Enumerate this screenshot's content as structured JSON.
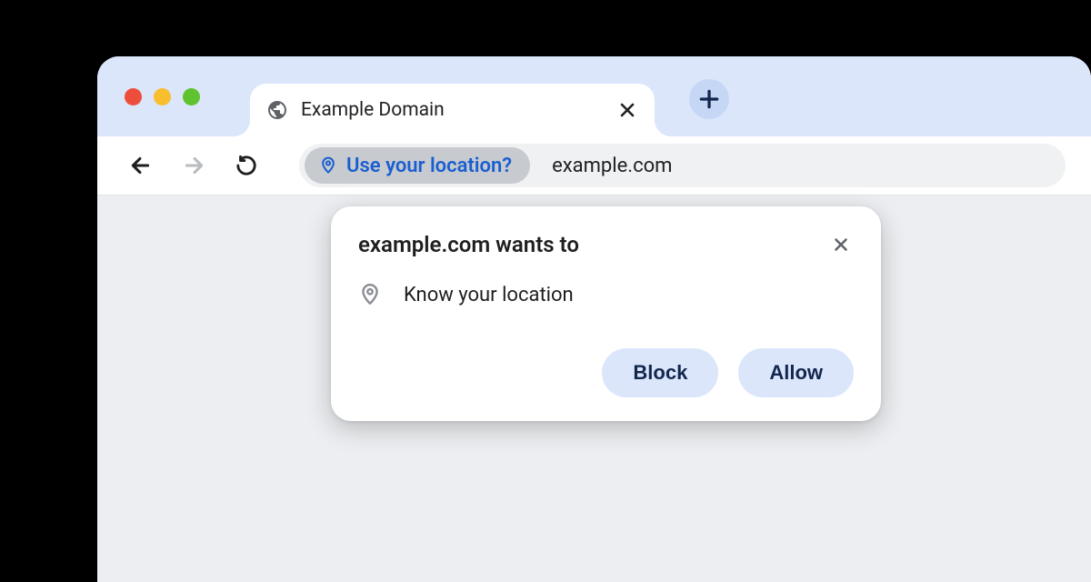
{
  "tab": {
    "title": "Example Domain"
  },
  "address": {
    "chip_label": "Use your location?",
    "url": "example.com"
  },
  "popup": {
    "title": "example.com wants to",
    "permission": "Know your location",
    "block_label": "Block",
    "allow_label": "Allow"
  }
}
